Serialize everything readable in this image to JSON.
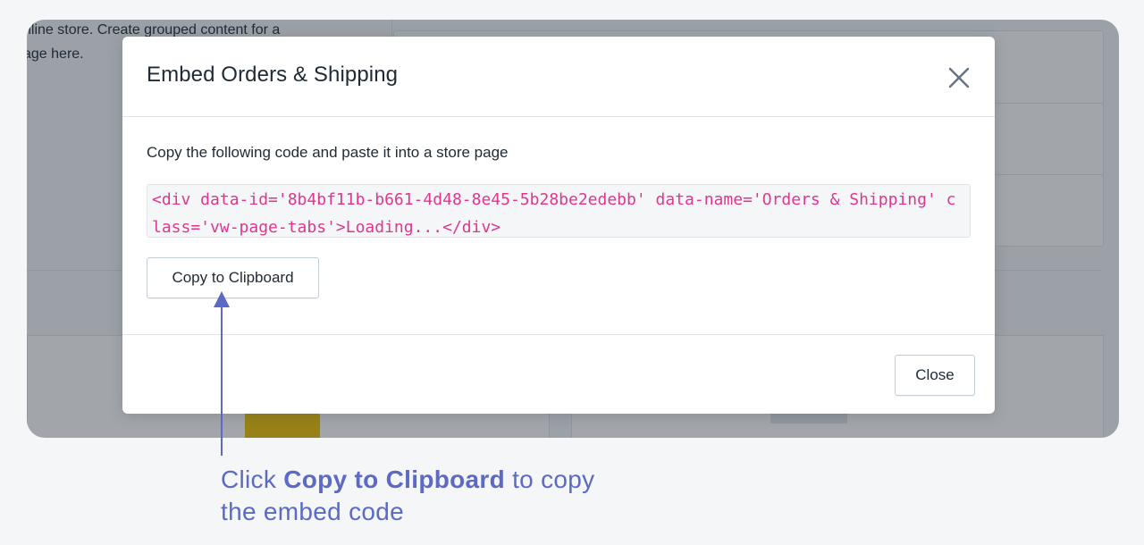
{
  "background": {
    "text_line1": "nline store. Create grouped content for a",
    "text_line2": "age here."
  },
  "modal": {
    "title": "Embed Orders & Shipping",
    "instructions": "Copy the following code and paste it into a store page",
    "embed_code": "<div data-id='8b4bf11b-b661-4d48-8e45-5b28be2edebb' data-name='Orders & Shipping' class='vw-page-tabs'>Loading...</div>",
    "copy_button_label": "Copy to Clipboard",
    "close_button_label": "Close"
  },
  "callout": {
    "prefix": "Click ",
    "highlight": "Copy to Clipboard",
    "suffix": " to copy the embed code"
  },
  "icons": {
    "close": "close-icon",
    "arrow": "arrow-up-icon"
  },
  "colors": {
    "accent": "#5c6ac4",
    "code_text": "#e0378e",
    "overlay": "rgba(33,43,54,0.42)",
    "text": "#212b36",
    "border": "#dfe3e8"
  }
}
